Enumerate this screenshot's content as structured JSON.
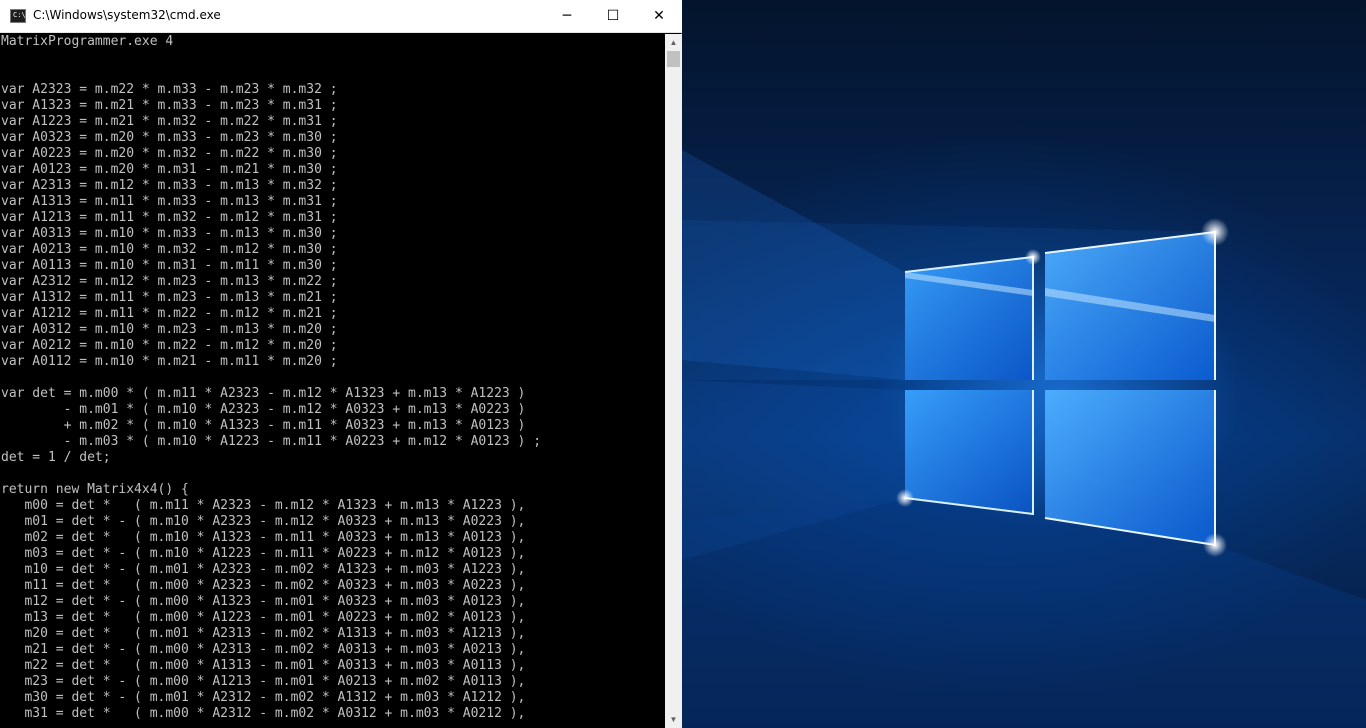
{
  "window": {
    "title": "C:\\Windows\\system32\\cmd.exe",
    "icon": "cmd-app-icon",
    "icon_glyph": "C:\\",
    "controls": {
      "minimize": "─",
      "maximize": "☐",
      "close": "✕"
    }
  },
  "console": {
    "lines": [
      "MatrixProgrammer.exe 4",
      "",
      "",
      "var A2323 = m.m22 * m.m33 - m.m23 * m.m32 ;",
      "var A1323 = m.m21 * m.m33 - m.m23 * m.m31 ;",
      "var A1223 = m.m21 * m.m32 - m.m22 * m.m31 ;",
      "var A0323 = m.m20 * m.m33 - m.m23 * m.m30 ;",
      "var A0223 = m.m20 * m.m32 - m.m22 * m.m30 ;",
      "var A0123 = m.m20 * m.m31 - m.m21 * m.m30 ;",
      "var A2313 = m.m12 * m.m33 - m.m13 * m.m32 ;",
      "var A1313 = m.m11 * m.m33 - m.m13 * m.m31 ;",
      "var A1213 = m.m11 * m.m32 - m.m12 * m.m31 ;",
      "var A0313 = m.m10 * m.m33 - m.m13 * m.m30 ;",
      "var A0213 = m.m10 * m.m32 - m.m12 * m.m30 ;",
      "var A0113 = m.m10 * m.m31 - m.m11 * m.m30 ;",
      "var A2312 = m.m12 * m.m23 - m.m13 * m.m22 ;",
      "var A1312 = m.m11 * m.m23 - m.m13 * m.m21 ;",
      "var A1212 = m.m11 * m.m22 - m.m12 * m.m21 ;",
      "var A0312 = m.m10 * m.m23 - m.m13 * m.m20 ;",
      "var A0212 = m.m10 * m.m22 - m.m12 * m.m20 ;",
      "var A0112 = m.m10 * m.m21 - m.m11 * m.m20 ;",
      "",
      "var det = m.m00 * ( m.m11 * A2323 - m.m12 * A1323 + m.m13 * A1223 )",
      "        - m.m01 * ( m.m10 * A2323 - m.m12 * A0323 + m.m13 * A0223 )",
      "        + m.m02 * ( m.m10 * A1323 - m.m11 * A0323 + m.m13 * A0123 )",
      "        - m.m03 * ( m.m10 * A1223 - m.m11 * A0223 + m.m12 * A0123 ) ;",
      "det = 1 / det;",
      "",
      "return new Matrix4x4() {",
      "   m00 = det *   ( m.m11 * A2323 - m.m12 * A1323 + m.m13 * A1223 ),",
      "   m01 = det * - ( m.m10 * A2323 - m.m12 * A0323 + m.m13 * A0223 ),",
      "   m02 = det *   ( m.m10 * A1323 - m.m11 * A0323 + m.m13 * A0123 ),",
      "   m03 = det * - ( m.m10 * A1223 - m.m11 * A0223 + m.m12 * A0123 ),",
      "   m10 = det * - ( m.m01 * A2323 - m.m02 * A1323 + m.m03 * A1223 ),",
      "   m11 = det *   ( m.m00 * A2323 - m.m02 * A0323 + m.m03 * A0223 ),",
      "   m12 = det * - ( m.m00 * A1323 - m.m01 * A0323 + m.m03 * A0123 ),",
      "   m13 = det *   ( m.m00 * A1223 - m.m01 * A0223 + m.m02 * A0123 ),",
      "   m20 = det *   ( m.m01 * A2313 - m.m02 * A1313 + m.m03 * A1213 ),",
      "   m21 = det * - ( m.m00 * A2313 - m.m02 * A0313 + m.m03 * A0213 ),",
      "   m22 = det *   ( m.m00 * A1313 - m.m01 * A0313 + m.m03 * A0113 ),",
      "   m23 = det * - ( m.m00 * A1213 - m.m01 * A0213 + m.m02 * A0113 ),",
      "   m30 = det * - ( m.m01 * A2312 - m.m02 * A1312 + m.m03 * A1212 ),",
      "   m31 = det *   ( m.m00 * A2312 - m.m02 * A0312 + m.m03 * A0212 ),"
    ],
    "text_color": "#c0c0c0",
    "background": "#000000"
  },
  "scrollbar": {
    "up_icon": "▲",
    "down_icon": "▼"
  },
  "desktop": {
    "wallpaper": "windows-10-hero-light-wallpaper",
    "accent": "#1e88ff"
  }
}
